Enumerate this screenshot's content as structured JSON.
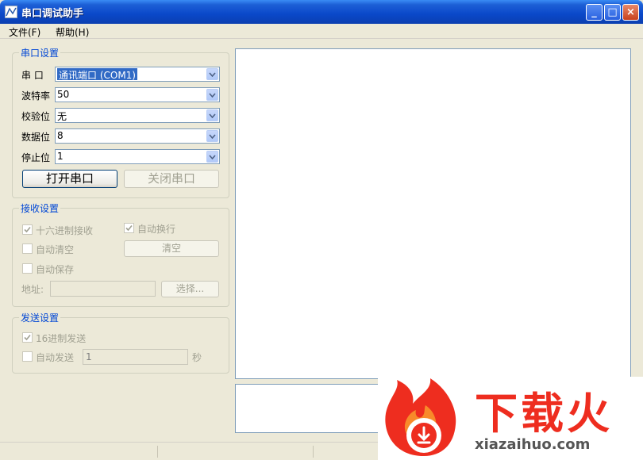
{
  "window": {
    "title": "串口调试助手",
    "minimize": "_",
    "maximize": "□",
    "close": "×"
  },
  "menu": [
    {
      "label": "文件(F)"
    },
    {
      "label": "帮助(H)"
    }
  ],
  "serial": {
    "title": "串口设置",
    "port": {
      "label": "串  口",
      "value": "通讯端口 (COM1)"
    },
    "baud": {
      "label": "波特率",
      "value": "50"
    },
    "parity": {
      "label": "校验位",
      "value": "无"
    },
    "databits": {
      "label": "数据位",
      "value": "8"
    },
    "stopbits": {
      "label": "停止位",
      "value": "1"
    },
    "open_btn": "打开串口",
    "close_btn": "关闭串口"
  },
  "receive": {
    "title": "接收设置",
    "hex": "十六进制接收",
    "auto_newline": "自动换行",
    "auto_clear": "自动清空",
    "clear_btn": "清空",
    "auto_save": "自动保存",
    "address_label": "地址:",
    "select_btn": "选择..."
  },
  "send": {
    "title": "发送设置",
    "hex": "16进制发送",
    "auto_send": "自动发送",
    "interval": "1",
    "unit": "秒"
  },
  "watermark": {
    "logo": "下载火",
    "url": "xiazaihuo.com"
  },
  "colors": {
    "accent": "#0046d5",
    "titlebar": "#0a48c9",
    "watermark": "#ee2d1f"
  }
}
